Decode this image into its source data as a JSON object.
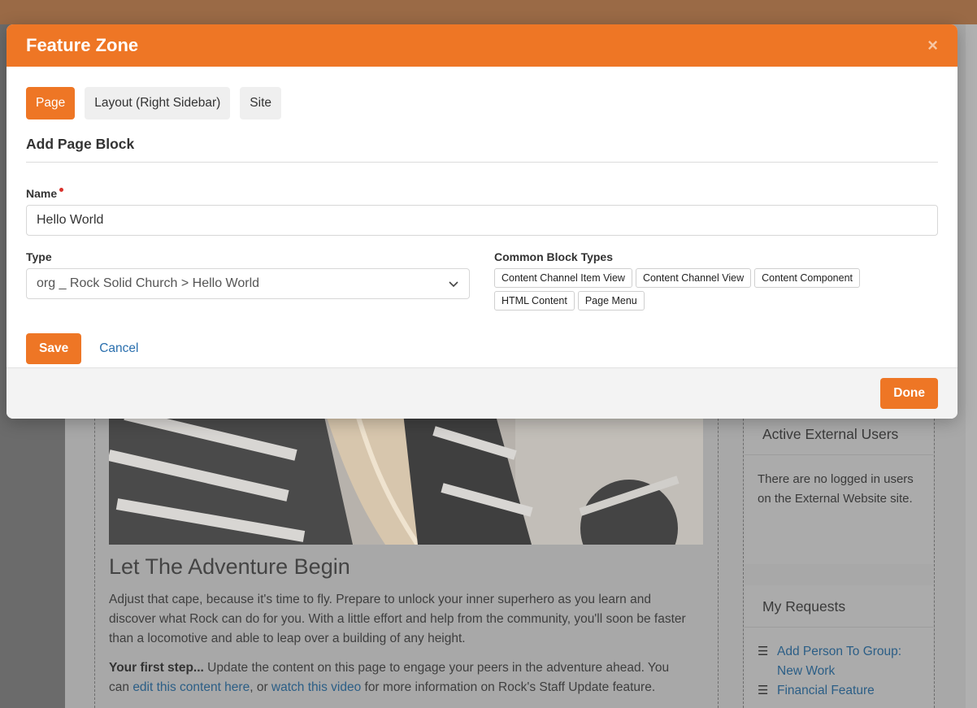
{
  "modal": {
    "title": "Feature Zone",
    "close_label": "×",
    "tabs": [
      {
        "label": "Page",
        "active": true
      },
      {
        "label": "Layout (Right Sidebar)",
        "active": false
      },
      {
        "label": "Site",
        "active": false
      }
    ],
    "section_title": "Add Page Block",
    "name_label": "Name",
    "name_value": "Hello World",
    "type_label": "Type",
    "type_value": "org _ Rock Solid Church > Hello World",
    "common_label": "Common Block Types",
    "common_block_types": [
      "Content Channel Item View",
      "Content Channel View",
      "Content Component",
      "HTML Content",
      "Page Menu"
    ],
    "save_label": "Save",
    "cancel_label": "Cancel",
    "done_label": "Done"
  },
  "background": {
    "heading": "Let The Adventure Begin",
    "para1": "Adjust that cape, because it's time to fly. Prepare to unlock your inner superhero as you learn and discover what Rock can do for you. With a little effort and help from the community, you'll soon be faster than a locomotive and able to leap over a building of any height.",
    "para2_bold": "Your first step...",
    "para2_a": " Update the content on this page to engage your peers in the adventure ahead. You can ",
    "para2_link1": "edit this content here",
    "para2_b": ", or ",
    "para2_link2": "watch this video",
    "para2_c": " for more information on Rock's Staff Update feature.",
    "active_users_title": "Active External Users",
    "active_users_body": "There are no logged in users on the External Website site.",
    "my_requests_title": "My Requests",
    "requests": [
      "Add Person To Group: New Work",
      "Financial Feature"
    ]
  },
  "colors": {
    "accent": "#ee7625",
    "link": "#2a6fae"
  }
}
